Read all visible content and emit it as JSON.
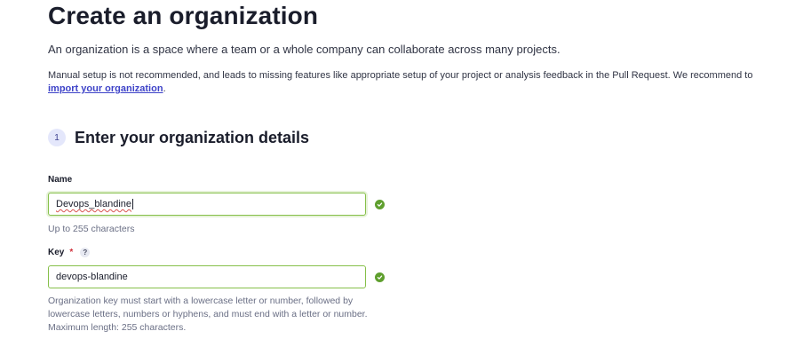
{
  "page": {
    "title": "Create an organization",
    "subtitle": "An organization is a space where a team or a whole company can collaborate across many projects.",
    "notice_text": "Manual setup is not recommended, and leads to missing features like appropriate setup of your project or analysis feedback in the Pull Request. We recommend to ",
    "notice_link": "import your organization",
    "notice_end": "."
  },
  "step": {
    "number": "1",
    "title": "Enter your organization details"
  },
  "name_field": {
    "label": "Name",
    "value": "Devops_blandine",
    "hint": "Up to 255 characters",
    "valid": true
  },
  "key_field": {
    "label": "Key",
    "required_mark": "*",
    "help_glyph": "?",
    "value": "devops-blandine",
    "hint": "Organization key must start with a lowercase letter or number, followed by lowercase letters, numbers or hyphens, and must end with a letter or number. Maximum length: 255 characters.",
    "valid": true
  },
  "colors": {
    "valid_border": "#86c04a",
    "valid_icon": "#5f9f2e",
    "link": "#3e43c8",
    "required": "#d02f3a"
  }
}
